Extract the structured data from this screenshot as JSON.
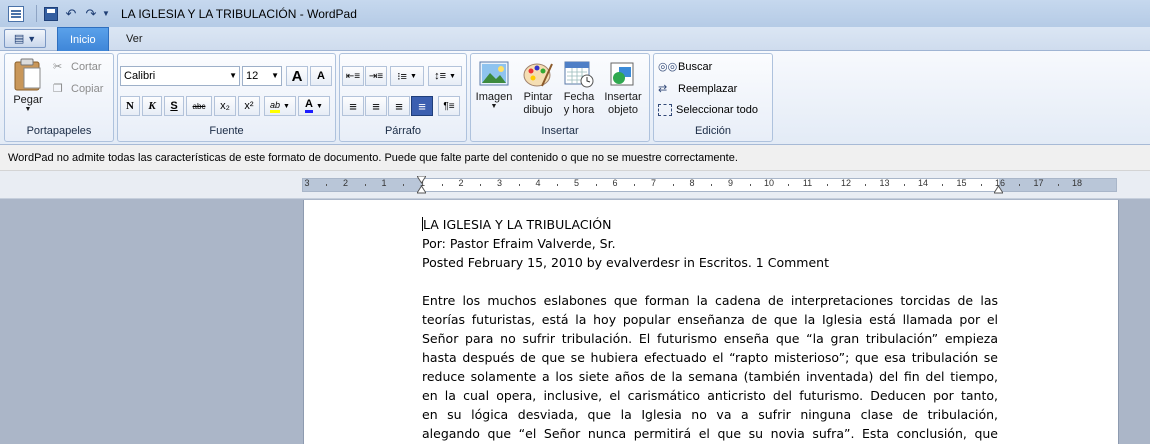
{
  "window": {
    "title": "LA IGLESIA Y LA TRIBULACIÓN - WordPad"
  },
  "tabs": [
    {
      "label": "Inicio",
      "active": true
    },
    {
      "label": "Ver",
      "active": false
    }
  ],
  "ribbon": {
    "portapapeles": {
      "label": "Portapapeles",
      "paste": "Pegar",
      "cut": "Cortar",
      "copy": "Copiar"
    },
    "fuente": {
      "label": "Fuente",
      "font_name": "Calibri",
      "font_size": "12",
      "grow_icon": "A",
      "shrink_icon": "A",
      "bold": "N",
      "italic": "K",
      "underline": "S",
      "strike": "abc",
      "subscript": "x₂",
      "superscript": "x²",
      "highlight": "ab",
      "color": "A"
    },
    "parrafo": {
      "label": "Párrafo"
    },
    "insertar": {
      "label": "Insertar",
      "image": "Imagen",
      "paint": [
        "Pintar",
        "dibujo"
      ],
      "datetime": [
        "Fecha",
        "y hora"
      ],
      "object": [
        "Insertar",
        "objeto"
      ]
    },
    "edicion": {
      "label": "Edición",
      "find": "Buscar",
      "replace": "Reemplazar",
      "select_all": "Seleccionar todo"
    }
  },
  "notification": "WordPad no admite todas las características de este formato de documento. Puede que falte parte del contenido o que no se muestre correctamente.",
  "ruler": {
    "labels": [
      "3",
      "2",
      "1",
      "1",
      "2",
      "3",
      "4",
      "5",
      "6",
      "7",
      "8",
      "9",
      "10",
      "11",
      "12",
      "13",
      "14",
      "15",
      "16",
      "17",
      "18"
    ]
  },
  "document": {
    "title": "LA IGLESIA Y LA TRIBULACIÓN",
    "author": "Por: Pastor Efraim Valverde, Sr.",
    "posted": "Posted February 15, 2010 by evalverdesr in Escritos. 1 Comment",
    "paragraph_lines": [
      "Entre los muchos eslabones que forman la cadena de interpretaciones torcidas de las",
      "teorías futuristas, está la hoy popular enseñanza de que la Iglesia está llamada por el",
      "Señor  para no sufrir tribulación. El futurismo enseña que “la gran tribulación” empieza",
      "hasta después de que se hubiera efectuado el “rapto misterioso”; que esa tribulación se",
      "reduce solamente a los siete años de la semana (también inventada) del fin del tiempo,",
      "en la cual opera, inclusive, el carismático anticristo del futurismo. Deducen  por tanto,",
      "en su lógica desviada, que la Iglesia no va a sufrir ninguna clase de tribulación,",
      "alegando que  “el Señor nunca permitirá el que su novia sufra”. Esta conclusión, que"
    ]
  }
}
